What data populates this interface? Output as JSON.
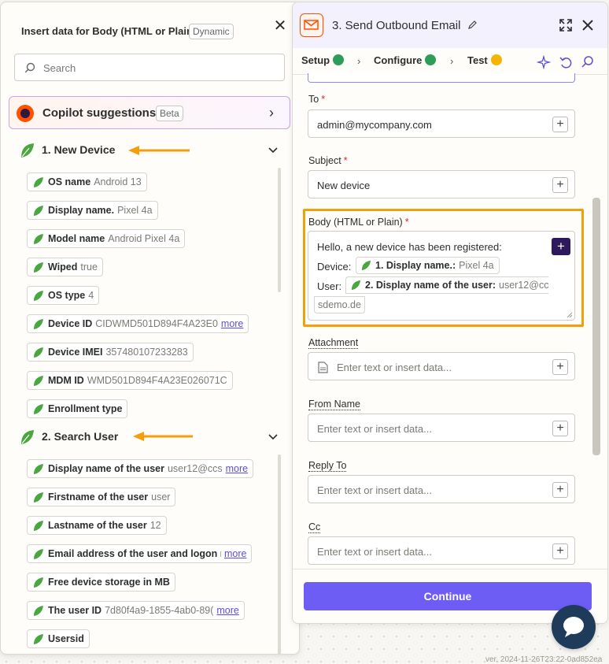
{
  "insert_panel": {
    "title": "Insert data for Body (HTML or Plain)",
    "badge": "Dynamic",
    "search_placeholder": "Search",
    "copilot": {
      "label": "Copilot suggestions",
      "badge": "Beta"
    },
    "sections": [
      {
        "label": "1.  New Device",
        "items": [
          {
            "name": "OS name",
            "value": "Android 13"
          },
          {
            "name": "Display name.",
            "value": "Pixel 4a"
          },
          {
            "name": "Model name",
            "value": "Android Pixel 4a"
          },
          {
            "name": "Wiped",
            "value": "true"
          },
          {
            "name": "OS type",
            "value": "4"
          },
          {
            "name": "Device ID",
            "value": "CIDWMD501D894F4A23E0",
            "more": "more"
          },
          {
            "name": "Device IMEI",
            "value": "357480107233283"
          },
          {
            "name": "MDM ID",
            "value": "WMD501D894F4A23E026071C"
          },
          {
            "name": "Enrollment type",
            "value": ""
          }
        ]
      },
      {
        "label": "2.  Search User",
        "items": [
          {
            "name": "Display name of the user",
            "value": "user12@ccs",
            "more": "more"
          },
          {
            "name": "Firstname of the user",
            "value": "user"
          },
          {
            "name": "Lastname of the user",
            "value": "12"
          },
          {
            "name": "Email address of the user and logon n",
            "value": "",
            "more": "more"
          },
          {
            "name": "Free device storage in MB",
            "value": ""
          },
          {
            "name": "The user ID",
            "value": "7d80f4a9-1855-4ab0-89(",
            "more": "more"
          },
          {
            "name": "Usersid",
            "value": ""
          }
        ]
      }
    ]
  },
  "step_panel": {
    "title": "3. Send Outbound Email",
    "tabs": [
      {
        "label": "Setup",
        "status": "complete"
      },
      {
        "label": "Configure",
        "status": "complete",
        "active": true
      },
      {
        "label": "Test",
        "status": "warning"
      }
    ],
    "fields": {
      "to": {
        "label": "To",
        "required": "*",
        "value": "admin@mycompany.com"
      },
      "subject": {
        "label": "Subject",
        "required": "*",
        "value": "New device"
      },
      "body": {
        "label": "Body (HTML or Plain)",
        "required": "*",
        "line1": "Hello, a new device has been registered:",
        "device_label": "Device:",
        "device_pill": {
          "name": "1. Display name.:",
          "value": "Pixel 4a"
        },
        "user_label": "User:",
        "user_pill": {
          "name": "2. Display name of the user:",
          "value": "user12@cc"
        },
        "user_pill_cont": "sdemo.de"
      },
      "attachment": {
        "label": "Attachment",
        "placeholder": "Enter text or insert data..."
      },
      "from_name": {
        "label": "From Name",
        "placeholder": "Enter text or insert data..."
      },
      "reply_to": {
        "label": "Reply To",
        "placeholder": "Enter text or insert data..."
      },
      "cc": {
        "label": "Cc",
        "placeholder": "Enter text or insert data..."
      }
    },
    "continue_label": "Continue"
  },
  "version": "ver. 2024-11-26T23:22-0ad852ea",
  "colors": {
    "accent": "#6d5df5",
    "zapier_orange": "#ff4f00",
    "highlight": "#f59e0b",
    "leaf_green": "#3f9b3a"
  }
}
